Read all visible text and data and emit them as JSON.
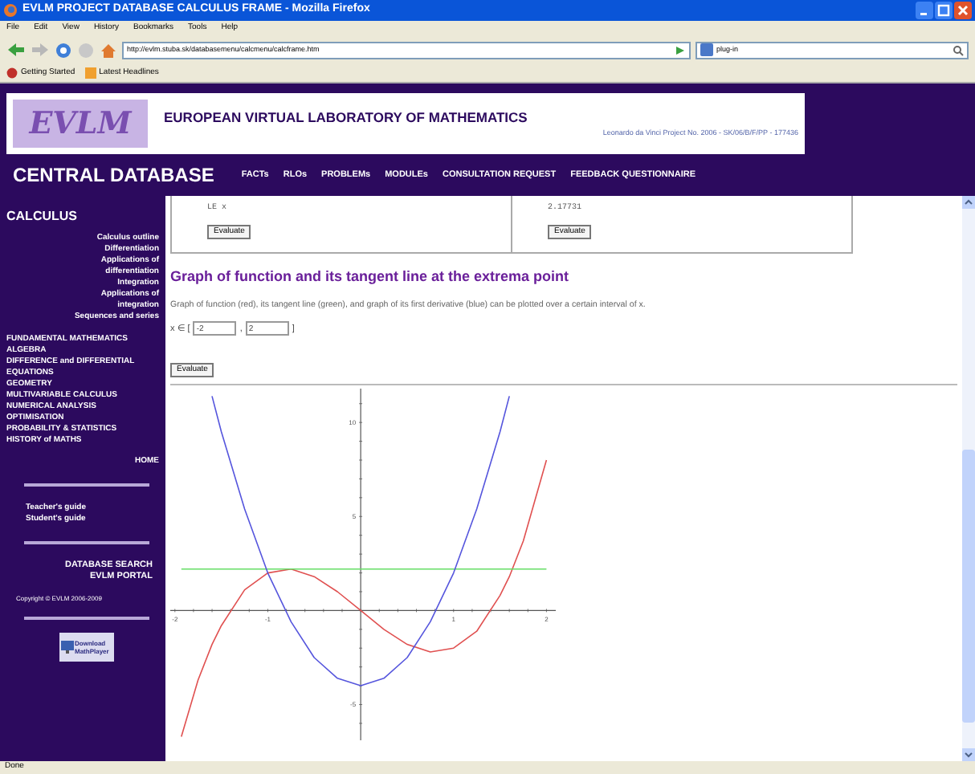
{
  "window": {
    "title": "EVLM PROJECT DATABASE CALCULUS FRAME - Mozilla Firefox"
  },
  "menu": [
    "File",
    "Edit",
    "View",
    "History",
    "Bookmarks",
    "Tools",
    "Help"
  ],
  "address": {
    "value": "http://evlm.stuba.sk/databasemenu/calcmenu/calcframe.htm"
  },
  "search": {
    "value": "plug-in"
  },
  "bookmarks": [
    "Getting Started",
    "Latest Headlines"
  ],
  "header": {
    "logo": "EVLM",
    "title": "EUROPEAN VIRTUAL LABORATORY OF MATHEMATICS",
    "project": "Leonardo da Vinci Project No. 2006 - SK/06/B/F/PP - 177436"
  },
  "nav": {
    "title": "CENTRAL DATABASE",
    "links": [
      "FACTs",
      "RLOs",
      "PROBLEMs",
      "MODULEs",
      "CONSULTATION REQUEST",
      "FEEDBACK QUESTIONNAIRE"
    ]
  },
  "sidebar": {
    "heading": "CALCULUS",
    "subitems": [
      "Calculus outline",
      "Differentiation",
      "Applications of differentiation",
      "Integration",
      "Applications of integration",
      "Sequences and series"
    ],
    "topics": [
      "FUNDAMENTAL MATHEMATICS",
      "ALGEBRA",
      "DIFFERENCE and DIFFERENTIAL EQUATIONS",
      "GEOMETRY",
      "MULTIVARIABLE CALCULUS",
      "NUMERICAL ANALYSIS",
      "OPTIMISATION",
      "PROBABILITY & STATISTICS",
      "HISTORY of MATHS"
    ],
    "home": "HOME",
    "guides": [
      "Teacher's guide",
      "Student's guide"
    ],
    "portal_links": [
      "DATABASE SEARCH",
      "EVLM PORTAL"
    ],
    "copyright": "Copyright © EVLM 2006-2009",
    "download": [
      "Download",
      "MathPlayer"
    ]
  },
  "result_cells": [
    {
      "text": "LE x",
      "button": "Evaluate"
    },
    {
      "text": "2.17731",
      "button": "Evaluate"
    }
  ],
  "section": {
    "title": "Graph of function and its tangent line at the extrema point",
    "description": "Graph of function (red), its tangent line (green), and graph of its first derivative (blue) can be plotted over a certain interval of x.",
    "interval_label": "x ∈ [",
    "from": "-2",
    "separator": ",",
    "to": "2",
    "close": "]",
    "button": "Evaluate",
    "chart_data": {
      "type": "line",
      "x": [
        -1.93,
        -1.75,
        -1.6,
        -1.5,
        -1.25,
        -1,
        -0.75,
        -0.5,
        -0.25,
        0,
        0.25,
        0.5,
        0.75,
        1,
        1.25,
        1.5,
        1.6,
        1.75,
        2
      ],
      "series": [
        {
          "color": "#e05050",
          "values": [
            -6.7,
            -3.7,
            -1.8,
            -0.8,
            1.1,
            2,
            2.2,
            1.8,
            1,
            0,
            -1,
            -1.8,
            -2.2,
            -2,
            -1.1,
            0.8,
            1.8,
            3.7,
            8
          ]
        },
        {
          "color": "#66dd66",
          "values": [
            2.2,
            2.2,
            2.2,
            2.2,
            2.2,
            2.2,
            2.2,
            2.2,
            2.2,
            2.2,
            2.2,
            2.2,
            2.2,
            2.2,
            2.2,
            2.2,
            2.2,
            2.2,
            2.2
          ]
        },
        {
          "color": "#5555dd",
          "values": [
            null,
            null,
            11.4,
            9.5,
            5.4,
            2,
            -0.6,
            -2.5,
            -3.6,
            -4,
            -3.6,
            -2.5,
            -0.6,
            2,
            5.4,
            9.5,
            11.4,
            null,
            null
          ]
        }
      ],
      "xlim": [
        -2.05,
        2.1
      ],
      "ylim": [
        -6.9,
        11.8
      ],
      "xticks": [
        {
          "value": -2,
          "label": "-2"
        },
        {
          "value": -1,
          "label": "-1"
        },
        {
          "value": 1,
          "label": "1"
        },
        {
          "value": 2,
          "label": "2"
        }
      ],
      "yticks": [
        {
          "value": 10,
          "label": "10"
        },
        {
          "value": 5,
          "label": "5"
        },
        {
          "value": -5,
          "label": "-5"
        }
      ]
    }
  },
  "status_bar": "Done"
}
